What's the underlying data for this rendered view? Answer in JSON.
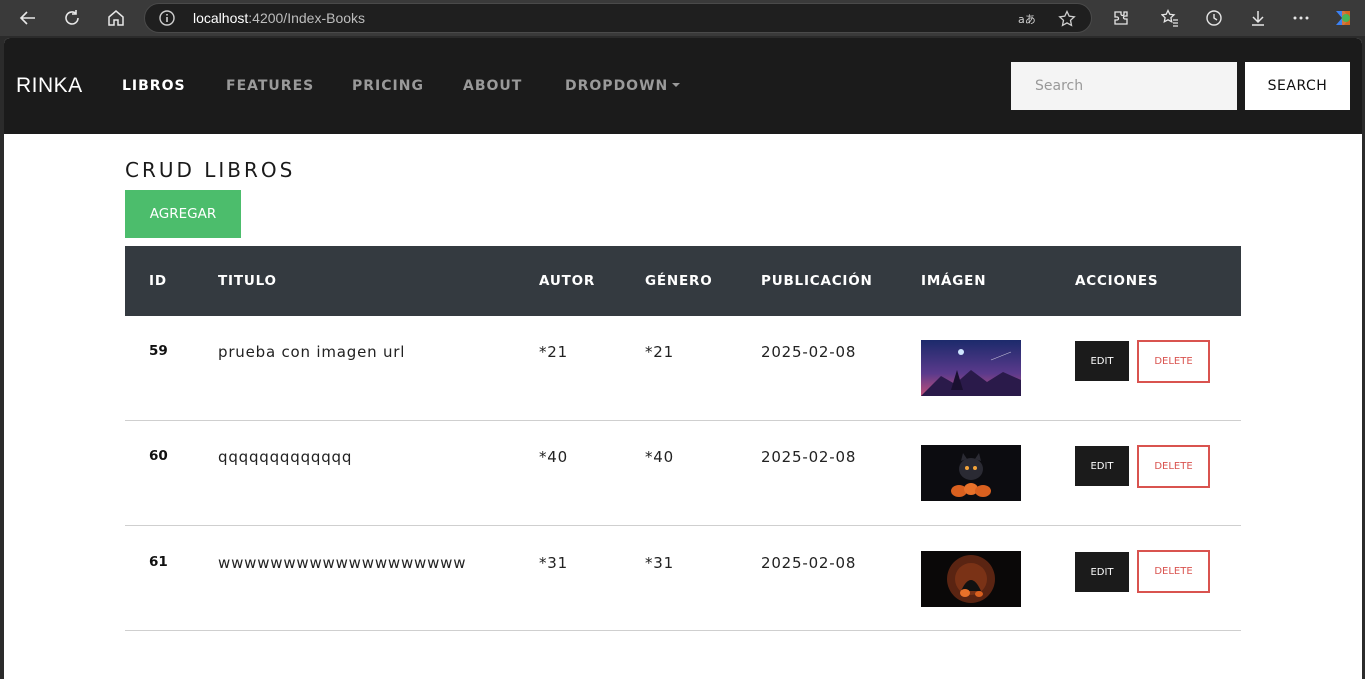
{
  "browser": {
    "url_host": "localhost",
    "url_rest": ":4200/Index-Books"
  },
  "navbar": {
    "brand": "RINKA",
    "links": [
      {
        "label": "LIBROS",
        "active": true
      },
      {
        "label": "FEATURES",
        "active": false
      },
      {
        "label": "PRICING",
        "active": false
      },
      {
        "label": "ABOUT",
        "active": false
      },
      {
        "label": "DROPDOWN",
        "active": false
      }
    ],
    "search_placeholder": "Search",
    "search_button": "SEARCH"
  },
  "page": {
    "title": "CRUD LIBROS",
    "add_button": "AGREGAR"
  },
  "table": {
    "headers": [
      "ID",
      "TITULO",
      "AUTOR",
      "GÉNERO",
      "PUBLICACIÓN",
      "IMÁGEN",
      "ACCIONES"
    ],
    "rows": [
      {
        "id": "59",
        "titulo": "prueba con imagen url",
        "autor": "*21",
        "genero": "*21",
        "publicacion": "2025-02-08",
        "edit": "EDIT",
        "delete": "DELETE"
      },
      {
        "id": "60",
        "titulo": "qqqqqqqqqqqqq",
        "autor": "*40",
        "genero": "*40",
        "publicacion": "2025-02-08",
        "edit": "EDIT",
        "delete": "DELETE"
      },
      {
        "id": "61",
        "titulo": "wwwwwwwwwwwwwwwwwww",
        "autor": "*31",
        "genero": "*31",
        "publicacion": "2025-02-08",
        "edit": "EDIT",
        "delete": "DELETE"
      }
    ]
  },
  "colors": {
    "navbar_bg": "#1b1b1b",
    "table_header_bg": "#343a40",
    "add_button_bg": "#4cbd6c",
    "delete_accent": "#d9534f"
  }
}
